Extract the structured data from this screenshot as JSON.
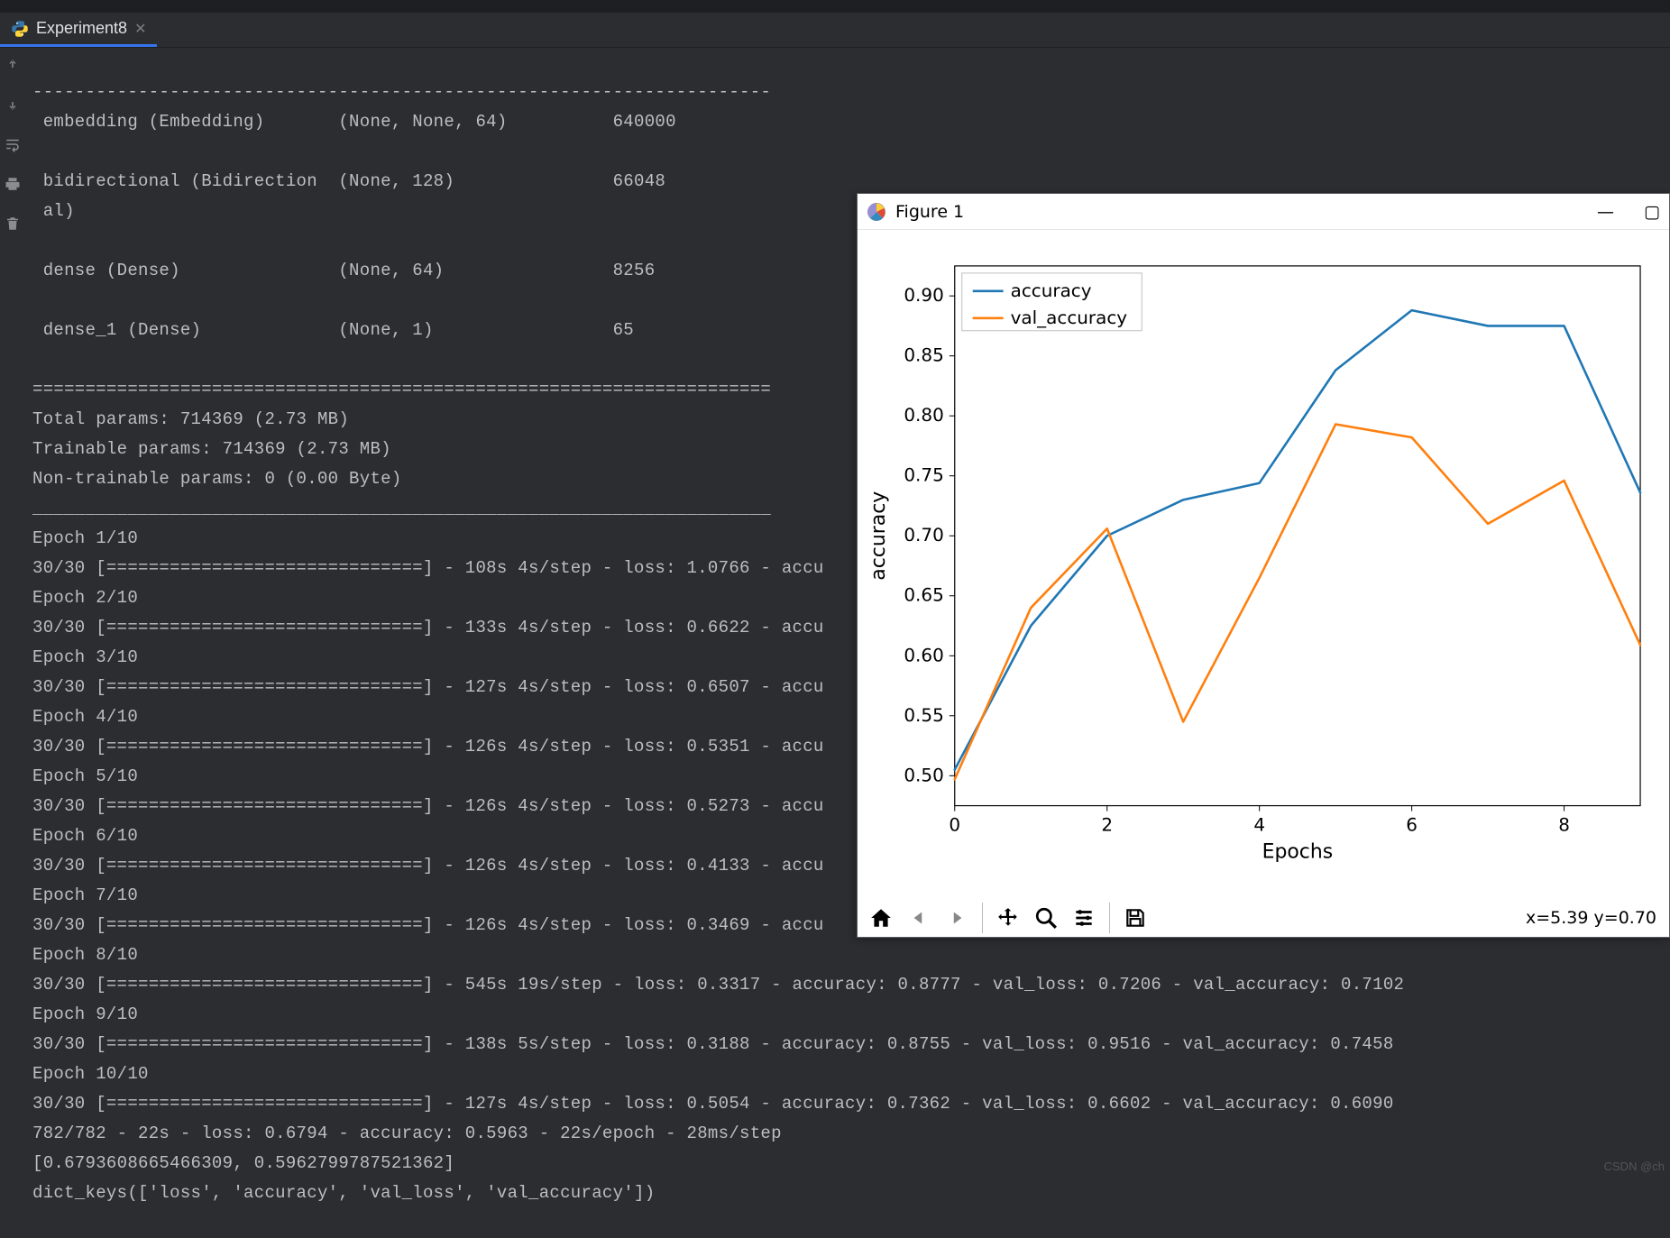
{
  "tab": {
    "label": "Experiment8"
  },
  "console": {
    "dash_line": "----------------------------------------------------------------------",
    "eq_line": "======================================================================",
    "under_line": "______________________________________________________________________",
    "layer_embedding": " embedding (Embedding)       (None, None, 64)          640000",
    "layer_bidi1": " bidirectional (Bidirection  (None, 128)               66048",
    "layer_bidi2": " al)",
    "layer_dense": " dense (Dense)               (None, 64)                8256",
    "layer_dense1": " dense_1 (Dense)             (None, 1)                 65",
    "total_params": "Total params: 714369 (2.73 MB)",
    "trainable": "Trainable params: 714369 (2.73 MB)",
    "nontrainable": "Non-trainable params: 0 (0.00 Byte)",
    "bar": "[==============================]",
    "epoch1_label": "Epoch 1/10",
    "epoch1_line": "30/30 [==============================] - 108s 4s/step - loss: 1.0766 - accu",
    "epoch2_label": "Epoch 2/10",
    "epoch2_line": "30/30 [==============================] - 133s 4s/step - loss: 0.6622 - accu",
    "epoch3_label": "Epoch 3/10",
    "epoch3_line": "30/30 [==============================] - 127s 4s/step - loss: 0.6507 - accu",
    "epoch4_label": "Epoch 4/10",
    "epoch4_line": "30/30 [==============================] - 126s 4s/step - loss: 0.5351 - accu",
    "epoch5_label": "Epoch 5/10",
    "epoch5_line": "30/30 [==============================] - 126s 4s/step - loss: 0.5273 - accu",
    "epoch6_label": "Epoch 6/10",
    "epoch6_line": "30/30 [==============================] - 126s 4s/step - loss: 0.4133 - accu",
    "epoch7_label": "Epoch 7/10",
    "epoch7_line": "30/30 [==============================] - 126s 4s/step - loss: 0.3469 - accu",
    "epoch8_label": "Epoch 8/10",
    "epoch8_line": "30/30 [==============================] - 545s 19s/step - loss: 0.3317 - accuracy: 0.8777 - val_loss: 0.7206 - val_accuracy: 0.7102",
    "epoch9_label": "Epoch 9/10",
    "epoch9_line": "30/30 [==============================] - 138s 5s/step - loss: 0.3188 - accuracy: 0.8755 - val_loss: 0.9516 - val_accuracy: 0.7458",
    "epoch10_label": "Epoch 10/10",
    "epoch10_line": "30/30 [==============================] - 127s 4s/step - loss: 0.5054 - accuracy: 0.7362 - val_loss: 0.6602 - val_accuracy: 0.6090",
    "evaluate": "782/782 - 22s - loss: 0.6794 - accuracy: 0.5963 - 22s/epoch - 28ms/step",
    "result_list": "[0.6793608665466309, 0.5962799787521362]",
    "dict_keys": "dict_keys(['loss', 'accuracy', 'val_loss', 'val_accuracy'])"
  },
  "figure": {
    "title": "Figure 1",
    "coords": "x=5.39  y=0.70"
  },
  "chart_data": {
    "type": "line",
    "xlabel": "Epochs",
    "ylabel": "accuracy",
    "categories": [
      0,
      1,
      2,
      3,
      4,
      5,
      6,
      7,
      8,
      9
    ],
    "xticks": [
      0,
      2,
      4,
      6,
      8
    ],
    "yticks": [
      0.5,
      0.55,
      0.6,
      0.65,
      0.7,
      0.75,
      0.8,
      0.85,
      0.9
    ],
    "ylim": [
      0.475,
      0.925
    ],
    "series": [
      {
        "name": "accuracy",
        "color": "#1f77b4",
        "values": [
          0.505,
          0.625,
          0.7,
          0.73,
          0.744,
          0.838,
          0.888,
          0.875,
          0.875,
          0.736
        ]
      },
      {
        "name": "val_accuracy",
        "color": "#ff7f0e",
        "values": [
          0.497,
          0.64,
          0.706,
          0.545,
          0.665,
          0.793,
          0.782,
          0.71,
          0.746,
          0.609
        ]
      }
    ]
  },
  "watermark": "CSDN @ch"
}
